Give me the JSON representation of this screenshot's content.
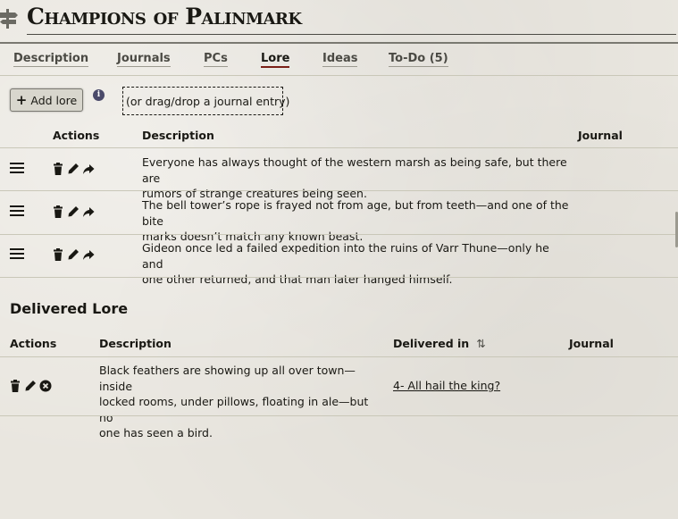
{
  "header": {
    "title": "Champions of Palinmark",
    "icon": "signpost-icon"
  },
  "tabs": [
    {
      "label": "Description",
      "active": false
    },
    {
      "label": "Journals",
      "active": false
    },
    {
      "label": "PCs",
      "active": false
    },
    {
      "label": "Lore",
      "active": true
    },
    {
      "label": "Ideas",
      "active": false
    },
    {
      "label": "To-Do (5)",
      "active": false
    }
  ],
  "toolbar": {
    "add_label": "Add lore",
    "drop_hint": "(or drag/drop a journal entry)"
  },
  "lore_table": {
    "headers": {
      "actions": "Actions",
      "description": "Description",
      "journal": "Journal"
    },
    "rows": [
      {
        "line1": "Everyone has always thought of the western marsh as being safe, but there are",
        "line2": "rumors of strange creatures being seen.",
        "journal": ""
      },
      {
        "line1": "The bell tower’s rope is frayed not from age, but from teeth—and one of the bite",
        "line2": "marks doesn’t match any known beast.",
        "journal": ""
      },
      {
        "line1": "Gideon once led a failed expedition into the ruins of Varr Thune—only he and",
        "line2": "one other returned, and that man later hanged himself.",
        "journal": ""
      }
    ]
  },
  "delivered": {
    "title": "Delivered Lore",
    "headers": {
      "actions": "Actions",
      "description": "Description",
      "delivered_in": "Delivered in",
      "journal": "Journal"
    },
    "rows": [
      {
        "line1": "Black feathers are showing up all over town—inside",
        "line2": "locked rooms, under pillows, floating in ale—but no",
        "line3": "one has seen a bird.",
        "delivered_in": "4- All hail the king?",
        "journal": ""
      }
    ]
  },
  "colors": {
    "background": "#e9e6df",
    "text": "#191813",
    "active_tab_underline": "#7a1f16",
    "info_icon": "#4a4a6a"
  }
}
